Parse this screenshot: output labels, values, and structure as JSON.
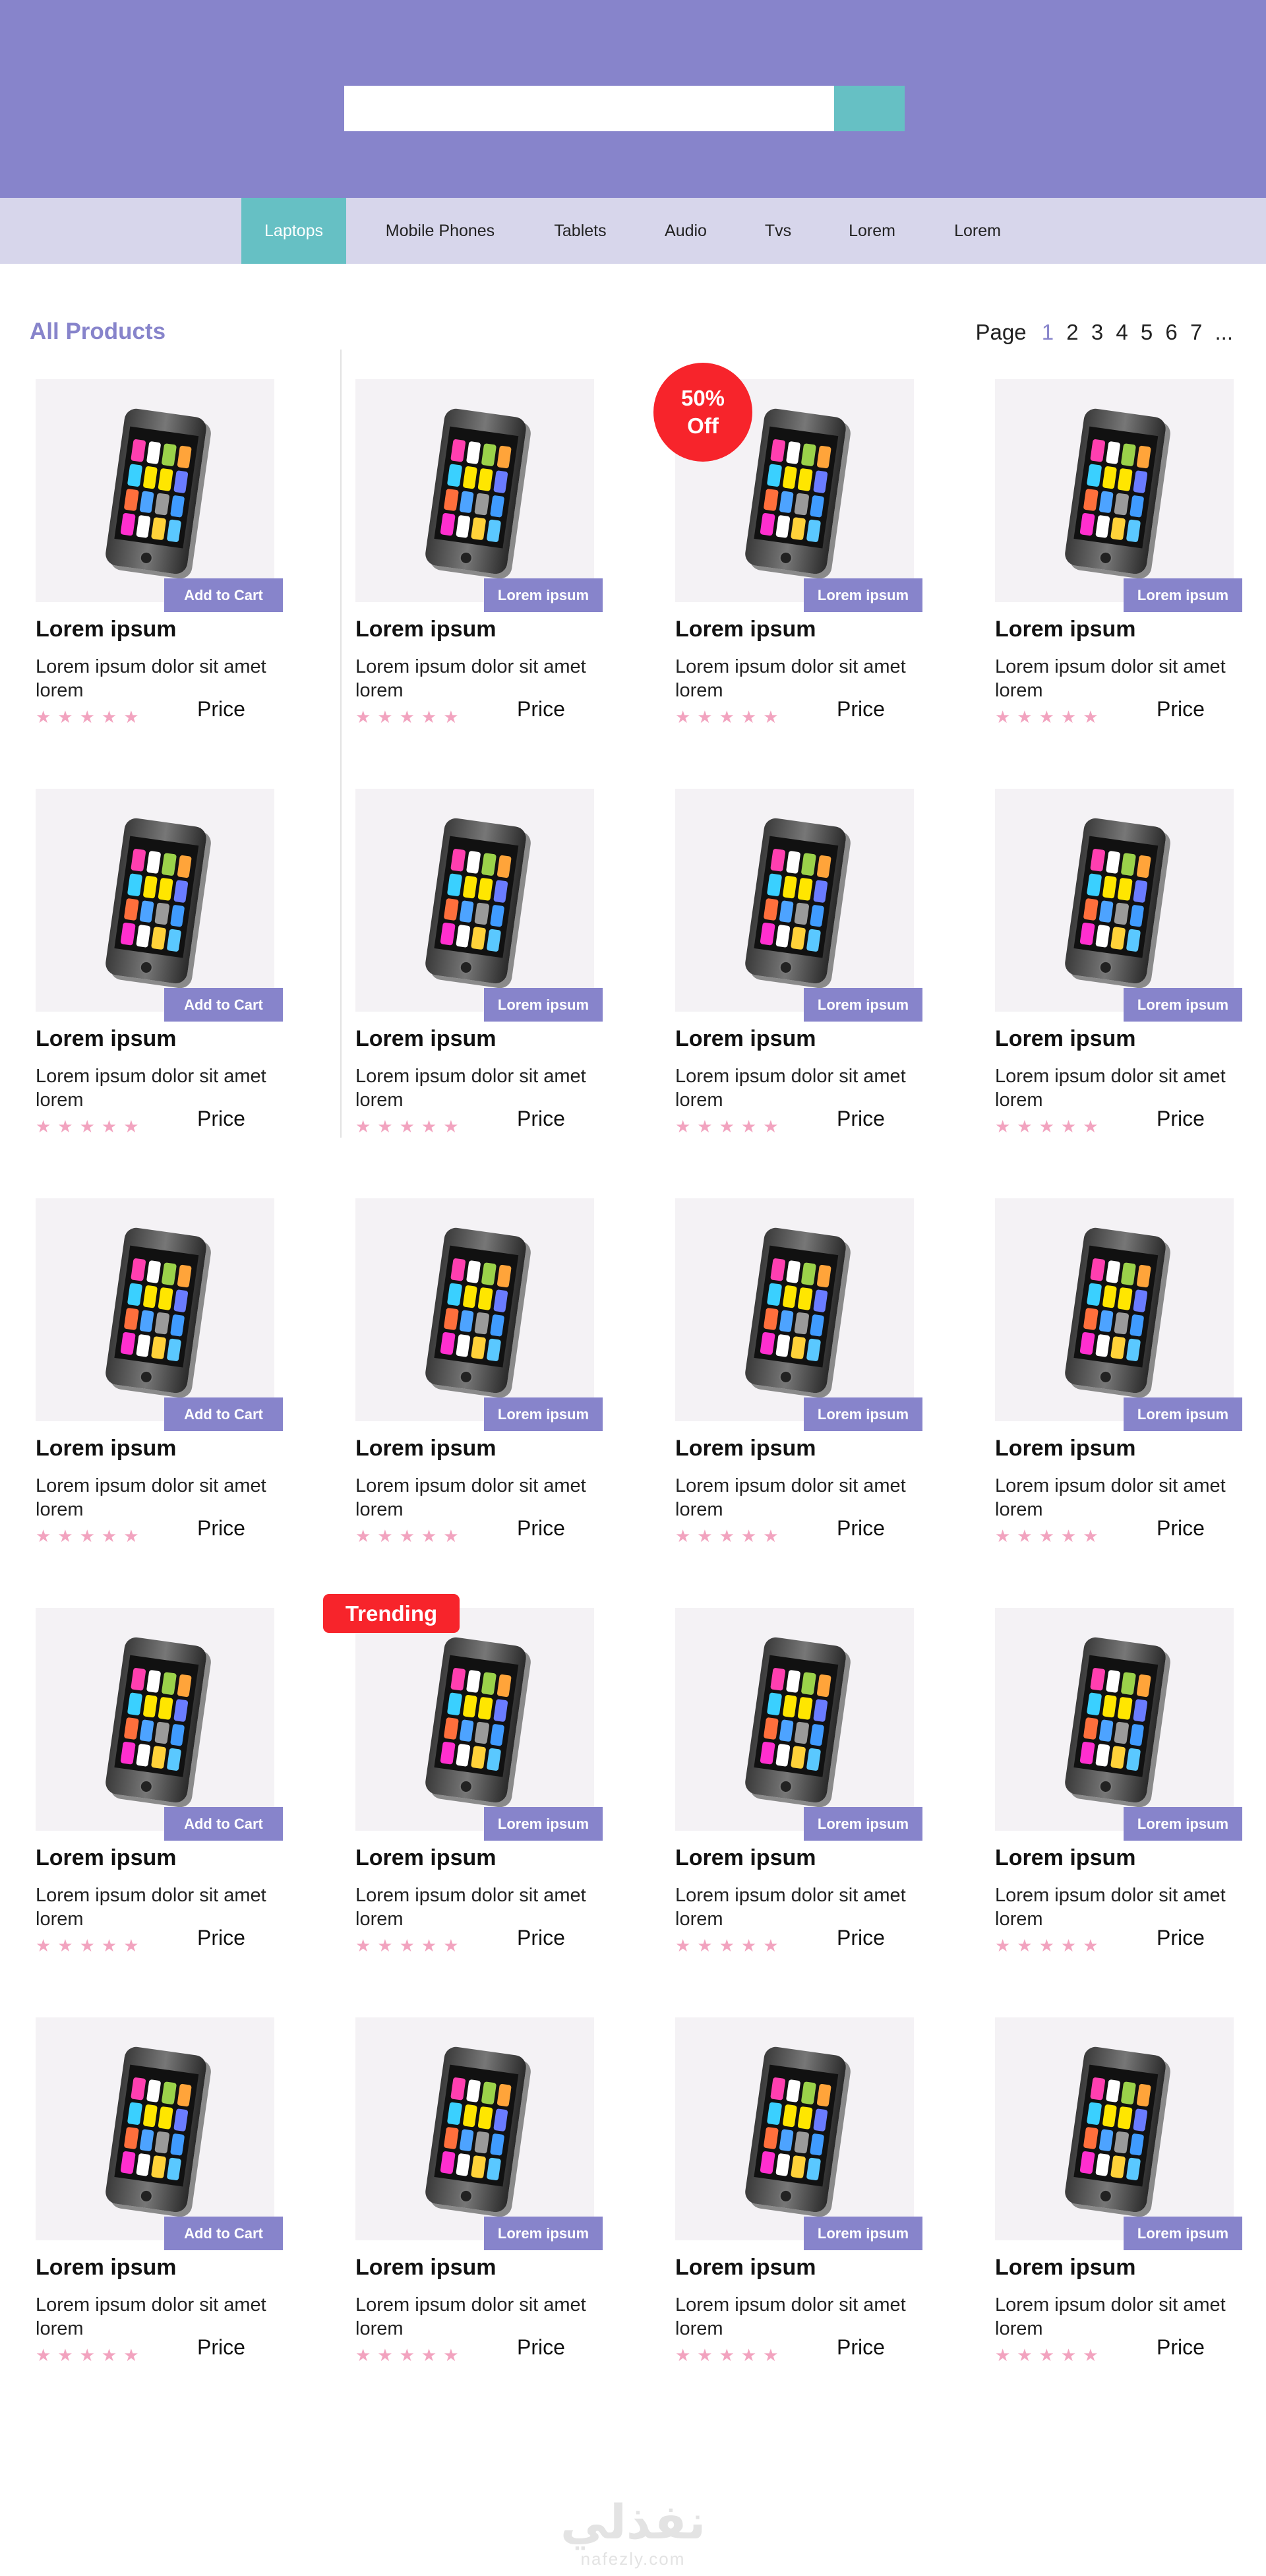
{
  "search": {
    "placeholder": ""
  },
  "nav": [
    {
      "label": "Laptops",
      "active": true
    },
    {
      "label": "Mobile Phones"
    },
    {
      "label": "Tablets"
    },
    {
      "label": "Audio"
    },
    {
      "label": "Tvs"
    },
    {
      "label": "Lorem"
    },
    {
      "label": "Lorem"
    }
  ],
  "section_title": "All Products",
  "pagination": {
    "label": "Page",
    "current": "1",
    "pages": [
      "2",
      "3",
      "4",
      "5",
      "6",
      "7"
    ],
    "ellipsis": "..."
  },
  "product_defaults": {
    "title": "Lorem ipsum",
    "description": "Lorem ipsum dolor sit amet lorem",
    "price": "Price",
    "rating_stars": 5
  },
  "buttons": {
    "first_column": "Add to Cart",
    "other_columns": "Lorem ipsum"
  },
  "badges": {
    "off": "50% Off",
    "trending": "Trending"
  },
  "footer": {
    "brand": "نفذلي",
    "url": "nafezly.com"
  },
  "colors": {
    "header": "#8784cb",
    "nav": "#d7d6eb",
    "accent_teal": "#66c0c4",
    "badge_red": "#f7242b",
    "star_pink": "#f2a3bf"
  }
}
